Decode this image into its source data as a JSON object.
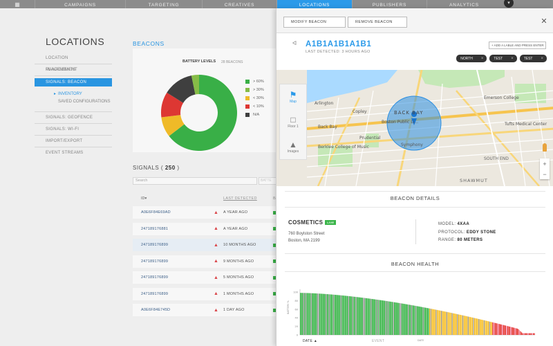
{
  "nav": {
    "tabs": [
      {
        "label": "CAMPAIGNS",
        "active": false
      },
      {
        "label": "TARGETING",
        "active": false
      },
      {
        "label": "CREATIVES",
        "active": false
      },
      {
        "label": "LOCATIONS",
        "active": true
      },
      {
        "label": "PUBLISHERS",
        "active": false
      },
      {
        "label": "ANALYTICS",
        "active": false
      }
    ],
    "menu_icon": "menu-icon",
    "extra_icon": "chevron-icon"
  },
  "sidebar": {
    "title": "LOCATIONS",
    "items": [
      {
        "label": "LOCATION MANAGEMENT"
      },
      {
        "label": "PLACEMENTS"
      },
      {
        "label": "SIGNALS: BEACON",
        "active": true
      },
      {
        "label": "INVENTORY",
        "sub": true,
        "selected": true
      },
      {
        "label": "SAVED CONFIGURATIONS",
        "sub": true
      },
      {
        "label": "SIGNALS: GEOFENCE"
      },
      {
        "label": "SIGNALS: WI-FI"
      },
      {
        "label": "IMPORT/EXPORT"
      },
      {
        "label": "EVENT STREAMS"
      }
    ]
  },
  "main": {
    "section_title": "BEACONS",
    "battery": {
      "title": "BATTERY LEVELS",
      "count": "28 BEACONS",
      "legend": [
        {
          "label": "> 60%",
          "color": "#3bb54a"
        },
        {
          "label": "> 30%",
          "color": "#8bc34a"
        },
        {
          "label": "< 30%",
          "color": "#f7c02a"
        },
        {
          "label": "< 10%",
          "color": "#e53935"
        },
        {
          "label": "N/A",
          "color": "#424242"
        }
      ]
    },
    "signals": {
      "title_prefix": "SIGNALS (",
      "count": "250",
      "title_suffix": ")",
      "search_placeholder": "Search",
      "search2_placeholder": "BATTE",
      "col_id": "ID",
      "col_last_detected": "LAST DETECTED",
      "col_battery": "BA",
      "rows": [
        {
          "id": "A0E6F84E69AD",
          "time": "A YEAR AGO"
        },
        {
          "id": "247189176881",
          "time": "A YEAR AGO"
        },
        {
          "id": "247189176899",
          "time": "10 MONTHS AGO",
          "highlight": true
        },
        {
          "id": "247189176899",
          "time": "9 MONTHS AGO"
        },
        {
          "id": "247189176899",
          "time": "5 MONTHS AGO"
        },
        {
          "id": "247189176899",
          "time": "1 MONTHS AGO"
        },
        {
          "id": "A0E6F84E745D",
          "time": "1 DAY AGO"
        }
      ]
    }
  },
  "panel": {
    "modify_label": "MODIFY BEACON",
    "remove_label": "REMOVE BEACON",
    "beacon_id": "A1B1A1B1A1B1",
    "last_detected": "LAST DETECTED: 3 HOURS AGO",
    "add_label": "+ ADD A LABLE AND PRESS ENTER",
    "tags": [
      "NORTH",
      "TEST",
      "TEST"
    ],
    "map": {
      "controls": [
        {
          "label": "Map",
          "selected": true
        },
        {
          "label": "Floor 1"
        },
        {
          "label": "Images"
        }
      ],
      "labels": [
        "BACK BAY",
        "Boston Public Li...",
        "SOUTH END",
        "SHAWMUT",
        "Tufts Medical Center",
        "Emerson College",
        "Arlington",
        "Copley",
        "Symphony",
        "Berklee College of Music",
        "Back Bay",
        "Prudential"
      ]
    },
    "details_title": "BEACON DETAILS",
    "venue": "COSMETICS",
    "venue_badge": "LIVE",
    "address_line1": "760 Boylston Street",
    "address_line2": "Boston, MA 2199",
    "model_label": "MODEL:",
    "model_value": "4XAA",
    "protocol_label": "PROTOCOL:",
    "protocol_value": "EDDY STONE",
    "range_label": "RANGE:",
    "range_value": "80 METERS",
    "health_title": "BEACON HEALTH",
    "health_chart_ylabel": "BATTERY %",
    "health_chart_xlabel": "DATE",
    "health_date_col": "DATE ▲",
    "health_event_col": "EVENT"
  },
  "chart_data": [
    {
      "type": "pie",
      "title": "BATTERY LEVELS",
      "categories": [
        "> 60%",
        "> 30%",
        "< 30%",
        "< 10%",
        "N/A"
      ],
      "values": [
        60,
        3,
        8,
        10,
        12
      ],
      "colors": [
        "#3bb54a",
        "#8bc34a",
        "#f7c02a",
        "#e53935",
        "#424242"
      ],
      "donut": true
    },
    {
      "type": "bar",
      "title": "BEACON HEALTH",
      "xlabel": "DATE",
      "ylabel": "BATTERY %",
      "ylim": [
        0,
        100
      ],
      "description_values_start": 98,
      "values_summary": {
        "start": 98,
        "end": 4,
        "count": 220
      }
    }
  ]
}
